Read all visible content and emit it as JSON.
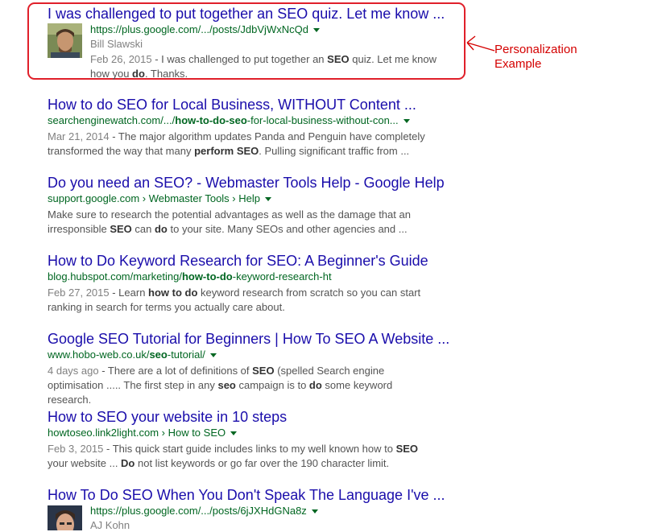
{
  "annotation": {
    "line1": "Personalization",
    "line2": "Example"
  },
  "results": [
    {
      "title": "I was challenged to put together an SEO quiz. Let me know ...",
      "url": "https://plus.google.com/.../posts/JdbVjWxNcQd",
      "author": "Bill Slawski",
      "date": "Feb 26, 2015",
      "snippet_a": " - I was challenged to put together an ",
      "snippet_b": "SEO",
      "snippet_c": " quiz. Let me know how you ",
      "snippet_d": "do",
      "snippet_e": ". Thanks."
    },
    {
      "title": "How to do SEO for Local Business, WITHOUT Content ...",
      "url_a": "searchenginewatch.com/.../",
      "url_b": "how-to-do-seo",
      "url_c": "-for-local-business-without-con...",
      "date": "Mar 21, 2014",
      "snippet_a": " - The major algorithm updates Panda and Penguin have completely transformed the way that many ",
      "snippet_b": "perform SEO",
      "snippet_c": ". Pulling significant traffic from ..."
    },
    {
      "title": "Do you need an SEO? - Webmaster Tools Help - Google Help",
      "url": "support.google.com › Webmaster Tools › Help",
      "snippet_a": "Make sure to research the potential advantages as well as the damage that an irresponsible ",
      "snippet_b": "SEO",
      "snippet_c": " can ",
      "snippet_d": "do",
      "snippet_e": " to your site. Many SEOs and other agencies and ..."
    },
    {
      "title": "How to Do Keyword Research for SEO: A Beginner's Guide",
      "url_a": "blog.hubspot.com/marketing/",
      "url_b": "how-to-do",
      "url_c": "-keyword-research-ht",
      "date": "Feb 27, 2015",
      "snippet_a": " - Learn ",
      "snippet_b": "how to do",
      "snippet_c": " keyword research from scratch so you can start ranking in search for terms you actually care about."
    },
    {
      "title": "Google SEO Tutorial for Beginners | How To SEO A Website ...",
      "url_a": "www.hobo-web.co.uk/",
      "url_b": "seo",
      "url_c": "-tutorial/",
      "date": "4 days ago",
      "snippet_a": " - There are a lot of definitions of ",
      "snippet_b": "SEO",
      "snippet_c": " (spelled Search engine optimisation ..... The first step in any ",
      "snippet_d": "seo",
      "snippet_e": " campaign is to ",
      "snippet_f": "do",
      "snippet_g": " some keyword research."
    },
    {
      "title": "How to SEO your website in 10 steps",
      "url": "howtoseo.link2light.com › How to SEO",
      "date": "Feb 3, 2015",
      "snippet_a": " - This quick start guide includes links to my well known how to ",
      "snippet_b": "SEO",
      "snippet_c": " your website ... ",
      "snippet_d": "Do",
      "snippet_e": " not list keywords or go far over the 190 character limit."
    },
    {
      "title": "How To Do SEO When You Don't Speak The Language I've ...",
      "url": "https://plus.google.com/.../posts/6jJXHdGNa8z",
      "author": "AJ Kohn"
    }
  ]
}
